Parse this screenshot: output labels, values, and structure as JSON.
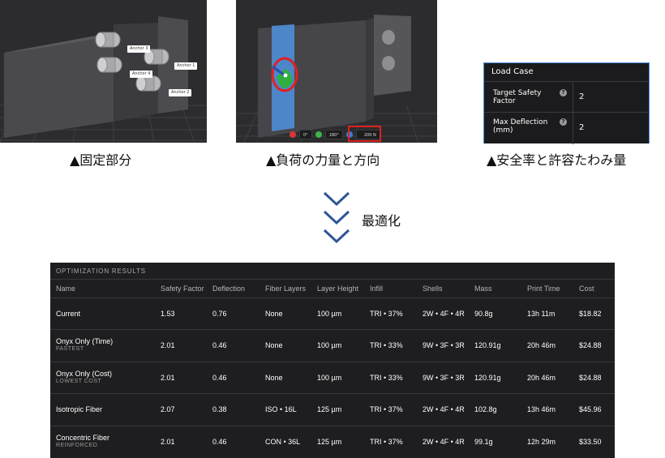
{
  "captions": {
    "fixed": "▲固定部分",
    "load": "▲負荷の力量と方向",
    "safety": "▲安全率と許容たわみ量"
  },
  "anchors": [
    "Anchor 3",
    "Anchor 1",
    "Anchor 4",
    "Anchor 2"
  ],
  "load_toolbar": {
    "angle1": "0°",
    "angle2": "180°",
    "force": "200 N",
    "colors": {
      "x": "#d93636",
      "y": "#3bb54a",
      "z": "#3a7bd5"
    }
  },
  "load_case": {
    "title": "Load Case",
    "rows": [
      {
        "label_line1": "Target Safety",
        "label_line2": "Factor",
        "help": "?",
        "value": "2"
      },
      {
        "label_line1": "Max Deflection",
        "label_line2": "(mm)",
        "help": "?",
        "value": "2"
      }
    ]
  },
  "optimize": {
    "label": "最適化"
  },
  "results": {
    "title": "OPTIMIZATION RESULTS",
    "headers": [
      "Name",
      "Safety Factor",
      "Deflection",
      "Fiber Layers",
      "Layer Height",
      "Infill",
      "Shells",
      "Mass",
      "Print Time",
      "Cost"
    ],
    "rows": [
      {
        "name": "Current",
        "sub": "",
        "cells": [
          "1.53",
          "0.76",
          "None",
          "100 µm",
          "TRI • 37%",
          "2W • 4F • 4R",
          "90.8g",
          "13h 11m",
          "$18.82"
        ]
      },
      {
        "name": "Onyx Only (Time)",
        "sub": "FASTEST",
        "cells": [
          "2.01",
          "0.46",
          "None",
          "100 µm",
          "TRI • 33%",
          "9W • 3F • 3R",
          "120.91g",
          "20h 46m",
          "$24.88"
        ]
      },
      {
        "name": "Onyx Only (Cost)",
        "sub": "LOWEST COST",
        "cells": [
          "2.01",
          "0.46",
          "None",
          "100 µm",
          "TRI • 33%",
          "9W • 3F • 3R",
          "120.91g",
          "20h 46m",
          "$24.88"
        ]
      },
      {
        "name": "Isotropic Fiber",
        "sub": "",
        "cells": [
          "2.07",
          "0.38",
          "ISO • 16L",
          "125 µm",
          "TRI • 37%",
          "2W • 4F • 4R",
          "102.8g",
          "13h 46m",
          "$45.96"
        ]
      },
      {
        "name": "Concentric Fiber",
        "sub": "REINFORCED",
        "cells": [
          "2.01",
          "0.46",
          "CON • 36L",
          "125 µm",
          "TRI • 37%",
          "2W • 4F • 4R",
          "99.1g",
          "12h 29m",
          "$33.50"
        ]
      }
    ]
  }
}
